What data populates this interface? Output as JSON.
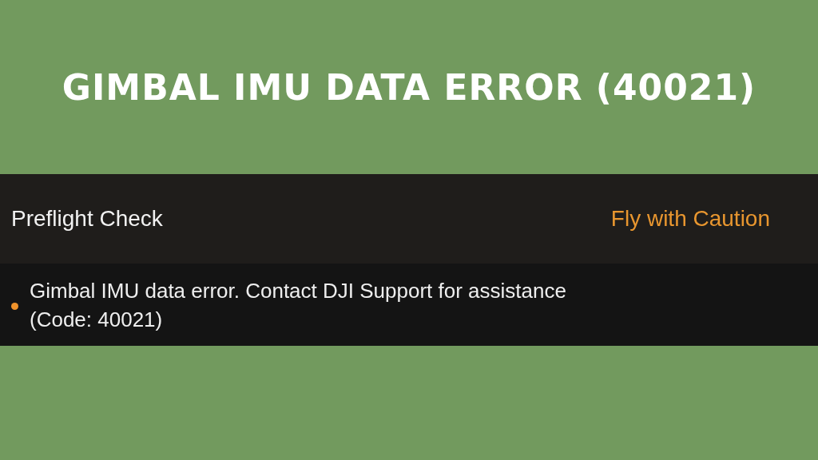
{
  "headline": "GIMBAL IMU DATA ERROR (40021)",
  "preflight": {
    "title": "Preflight Check",
    "status": "Fly with Caution",
    "messages": [
      {
        "text": "Gimbal IMU data error. Contact DJI Support for assistance (Code: 40021)"
      }
    ]
  }
}
